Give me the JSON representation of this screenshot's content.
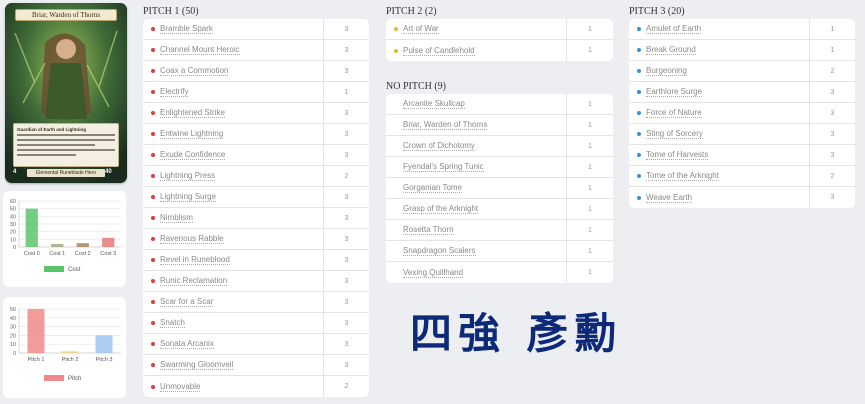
{
  "hero": {
    "name": "Briar, Warden of Thorns",
    "type_line": "Elemental Runeblade Hero",
    "intellect": "4",
    "life": "40",
    "text_title": "Guardian of Earth and Lightning"
  },
  "cost_chart": {
    "chart_data": {
      "type": "bar",
      "categories": [
        "Cost 0",
        "Cost 1",
        "Cost 2",
        "Cost 3"
      ],
      "values": [
        50,
        4,
        5,
        12
      ],
      "ylim": [
        0,
        60
      ],
      "yticks": [
        "0",
        "10",
        "20",
        "30",
        "40",
        "50",
        "60"
      ],
      "colors": [
        "#5cc46b",
        "#a8a77f",
        "#a4865a",
        "#e27b78"
      ],
      "legend": "Cost",
      "legend_color": "#5cc46b",
      "legend_position": "bottom"
    }
  },
  "pitch_chart": {
    "chart_data": {
      "type": "bar",
      "categories": [
        "Pitch 1",
        "Pitch 2",
        "Pitch 3"
      ],
      "values": [
        50,
        2,
        20
      ],
      "ylim": [
        0,
        50
      ],
      "yticks": [
        "0",
        "10",
        "20",
        "30",
        "40",
        "50"
      ],
      "colors": [
        "#f08a8a",
        "#f2d27a",
        "#9cc4f2"
      ],
      "legend": "Pitch",
      "legend_color": "#f08a8a",
      "legend_position": "bottom"
    }
  },
  "columns": {
    "pitch1": {
      "title": "PITCH 1 (50)",
      "dot_color": "#e23b3b",
      "cards": [
        {
          "name": "Bramble Spark",
          "qty": "3"
        },
        {
          "name": "Channel Mount Heroic",
          "qty": "3"
        },
        {
          "name": "Coax a Commotion",
          "qty": "3"
        },
        {
          "name": "Electrify",
          "qty": "1"
        },
        {
          "name": "Enlightened Strike",
          "qty": "3"
        },
        {
          "name": "Entwine Lightning",
          "qty": "3"
        },
        {
          "name": "Exude Confidence",
          "qty": "3"
        },
        {
          "name": "Lightning Press",
          "qty": "2"
        },
        {
          "name": "Lightning Surge",
          "qty": "3"
        },
        {
          "name": "Nimblism",
          "qty": "3"
        },
        {
          "name": "Ravenous Rabble",
          "qty": "3"
        },
        {
          "name": "Revel in Runeblood",
          "qty": "3"
        },
        {
          "name": "Runic Reclamation",
          "qty": "3"
        },
        {
          "name": "Scar for a Scar",
          "qty": "3"
        },
        {
          "name": "Snatch",
          "qty": "3"
        },
        {
          "name": "Sonata Arcanix",
          "qty": "3"
        },
        {
          "name": "Swarming Gloomveil",
          "qty": "3"
        },
        {
          "name": "Unmovable",
          "qty": "2"
        }
      ]
    },
    "pitch2": {
      "title": "PITCH 2 (2)",
      "dot_color": "#e8b730",
      "cards": [
        {
          "name": "Art of War",
          "qty": "1"
        },
        {
          "name": "Pulse of Candlehold",
          "qty": "1"
        }
      ]
    },
    "nopitch": {
      "title": "NO PITCH (9)",
      "cards": [
        {
          "name": "Arcanite Skullcap",
          "qty": "1"
        },
        {
          "name": "Briar, Warden of Thorns",
          "qty": "1"
        },
        {
          "name": "Crown of Dichotomy",
          "qty": "1"
        },
        {
          "name": "Fyendal's Spring Tunic",
          "qty": "1"
        },
        {
          "name": "Gorganian Tome",
          "qty": "1"
        },
        {
          "name": "Grasp of the Arknight",
          "qty": "1"
        },
        {
          "name": "Rosetta Thorn",
          "qty": "1"
        },
        {
          "name": "Snapdragon Scalers",
          "qty": "1"
        },
        {
          "name": "Vexing Quillhand",
          "qty": "1"
        }
      ]
    },
    "pitch3": {
      "title": "PITCH 3 (20)",
      "dot_color": "#3a8fe0",
      "cards": [
        {
          "name": "Amulet of Earth",
          "qty": "1"
        },
        {
          "name": "Break Ground",
          "qty": "1"
        },
        {
          "name": "Burgeoning",
          "qty": "2"
        },
        {
          "name": "Earthlore Surge",
          "qty": "3"
        },
        {
          "name": "Force of Nature",
          "qty": "3"
        },
        {
          "name": "Sting of Sorcery",
          "qty": "3"
        },
        {
          "name": "Tome of Harvests",
          "qty": "3"
        },
        {
          "name": "Tome of the Arknight",
          "qty": "2"
        },
        {
          "name": "Weave Earth",
          "qty": "3"
        }
      ]
    }
  },
  "overlay": {
    "text": "四強 彥勳",
    "color": "#0d2a78"
  }
}
